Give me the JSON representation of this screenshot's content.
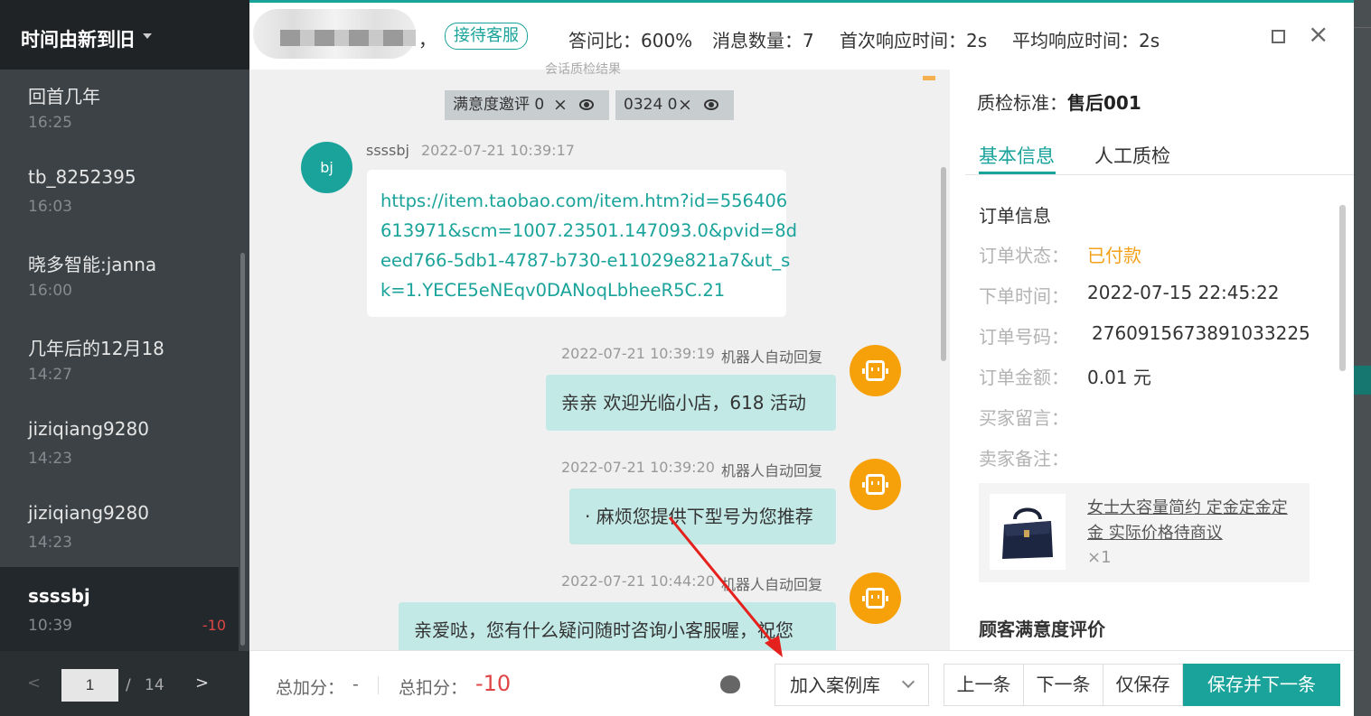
{
  "sidebar": {
    "sort_label": "时间由新到旧",
    "sessions": [
      {
        "name": "回首几年",
        "time": "16:25",
        "score": ""
      },
      {
        "name": "tb_8252395",
        "time": "16:03",
        "score": ""
      },
      {
        "name": "晓多智能:janna",
        "time": "16:00",
        "score": ""
      },
      {
        "name": "几年后的12月18",
        "time": "14:27",
        "score": ""
      },
      {
        "name": "jiziqiang9280",
        "time": "14:23",
        "score": ""
      },
      {
        "name": "jiziqiang9280",
        "time": "14:23",
        "score": ""
      },
      {
        "name": "ssssbj",
        "time": "10:39",
        "score": "-10"
      }
    ],
    "pager": {
      "prev": "<",
      "current": "1",
      "slash": "/",
      "total": "14",
      "next": ">"
    }
  },
  "header": {
    "comma": "，",
    "badge": "接待客服",
    "stats": [
      "答问比：600%",
      "消息数量：7",
      "首次响应时间：2s",
      "平均响应时间：2s"
    ],
    "close": "×"
  },
  "chat": {
    "cutoff_text": "会话质检结果",
    "tags": [
      {
        "label": "满意度邀评 0",
        "x": "×"
      },
      {
        "label": "0324 0",
        "x": "×"
      }
    ],
    "customer": {
      "avatar": "bj",
      "name": "ssssbj",
      "time": "2022-07-21 10:39:17",
      "url_lines": [
        "https://item.taobao.com/item.htm?id=556406",
        "613971&scm=1007.23501.147093.0&pvid=8d",
        "eed766-5db1-4787-b730-e11029e821a7&ut_s",
        "k=1.YECE5eNEqv0DANoqLbheeR5C.21"
      ]
    },
    "bot_messages": [
      {
        "time": "2022-07-21 10:39:19",
        "label": "机器人自动回复",
        "text": "亲亲 欢迎光临小店，618 活动"
      },
      {
        "time": "2022-07-21 10:39:20",
        "label": "机器人自动回复",
        "text": "· 麻烦您提供下型号为您推荐"
      },
      {
        "time": "2022-07-21 10:44:20",
        "label": "机器人自动回复",
        "text": "亲爱哒，您有什么疑问随时咨询小客服喔，祝您"
      }
    ]
  },
  "right": {
    "standard_label": "质检标准：",
    "standard_value": "售后001",
    "tabs": [
      "基本信息",
      "人工质检"
    ],
    "section": "订单信息",
    "order": [
      {
        "label": "订单状态：",
        "value": "已付款"
      },
      {
        "label": "下单时间：",
        "value": "2022-07-15 22:45:22"
      },
      {
        "label": "订单号码：",
        "value": "276091567389103322​5"
      },
      {
        "label": "订单金额：",
        "value": "0.01 元"
      },
      {
        "label": "买家留言：",
        "value": ""
      },
      {
        "label": "卖家备注：",
        "value": ""
      }
    ],
    "product": {
      "name": "女士大容量简约 定金定金定金 实际价格待商议",
      "qty": "×1"
    },
    "satisfaction": "顾客满意度评价"
  },
  "footer": {
    "add_label": "总加分：",
    "add_value": "-",
    "deduct_label": "总扣分：",
    "deduct_value": "-10",
    "case_select": "加入案例库",
    "prev": "上一条",
    "next": "下一条",
    "save": "仅保存",
    "save_next": "保存并下一条"
  },
  "colors": {
    "accent": "#1aa39a",
    "bot": "#f7a10a",
    "deduct": "#e04545",
    "paid": "#f3a11b"
  }
}
